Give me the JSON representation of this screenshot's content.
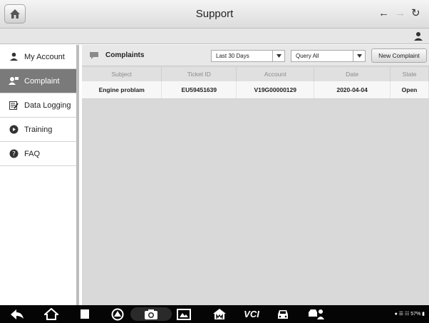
{
  "header": {
    "title": "Support",
    "icons": {
      "home": "home-icon",
      "back": "arrow-left-icon",
      "forward": "arrow-right-icon",
      "refresh": "refresh-icon"
    },
    "user_icon": "user-icon"
  },
  "sidebar": {
    "items": [
      {
        "label": "My Account",
        "icon": "user-icon",
        "active": false
      },
      {
        "label": "Complaint",
        "icon": "complaint-user-icon",
        "active": true
      },
      {
        "label": "Data Logging",
        "icon": "edit-note-icon",
        "active": false
      },
      {
        "label": "Training",
        "icon": "play-icon",
        "active": false
      },
      {
        "label": "FAQ",
        "icon": "help-icon",
        "active": false
      }
    ]
  },
  "main": {
    "title": "Complaints",
    "period_select": "Last 30 Days",
    "query_select": "Query All",
    "new_button": "New Complaint",
    "table": {
      "columns": [
        "Subject",
        "Ticket ID",
        "Account",
        "Date",
        "State"
      ],
      "rows": [
        [
          "Engine problam",
          "EU59451639",
          "V19G00000129",
          "2020-04-04",
          "Open"
        ]
      ]
    }
  },
  "bottombar": {
    "vci_label": "VCI",
    "status_text": "57%"
  },
  "colors": {
    "sidebar_active": "#7a7a7a",
    "main_bg": "#d9d9d9",
    "bottombar": "#050505"
  }
}
